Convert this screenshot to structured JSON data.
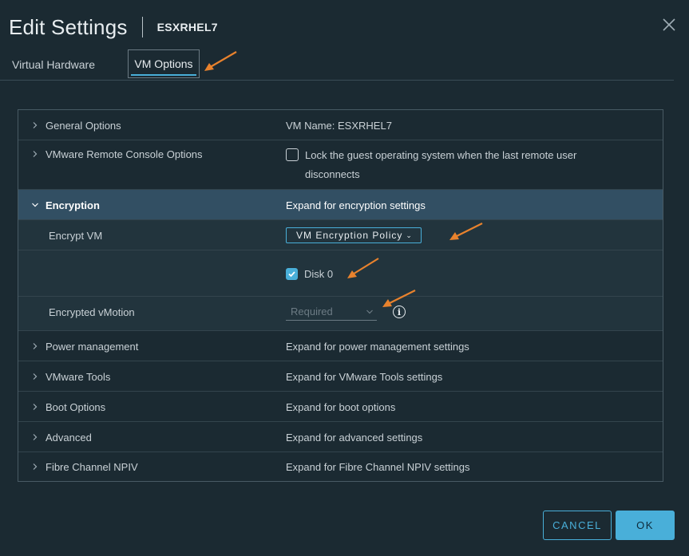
{
  "header": {
    "title": "Edit Settings",
    "subtitle": "ESXRHEL7"
  },
  "tabs": [
    {
      "label": "Virtual Hardware",
      "active": false
    },
    {
      "label": "VM Options",
      "active": true
    }
  ],
  "rows": {
    "general": {
      "label": "General Options",
      "value": "VM Name: ESXRHEL7"
    },
    "remote_console": {
      "label": "VMware Remote Console Options",
      "checkbox_label_line1": "Lock the guest operating system when the last remote user",
      "checkbox_label_line2": "disconnects",
      "checked": false
    },
    "encryption": {
      "label": "Encryption",
      "value": "Expand for encryption settings"
    },
    "encrypt_vm": {
      "label": "Encrypt VM",
      "policy": "VM Encryption Policy"
    },
    "disk": {
      "label": "Disk 0",
      "checked": true
    },
    "encrypted_vmotion": {
      "label": "Encrypted vMotion",
      "selected": "Required"
    },
    "power": {
      "label": "Power management",
      "value": "Expand for power management settings"
    },
    "tools": {
      "label": "VMware Tools",
      "value": "Expand for VMware Tools settings"
    },
    "boot": {
      "label": "Boot Options",
      "value": "Expand for boot options"
    },
    "advanced": {
      "label": "Advanced",
      "value": "Expand for advanced settings"
    },
    "npiv": {
      "label": "Fibre Channel NPIV",
      "value": "Expand for Fibre Channel NPIV settings"
    }
  },
  "footer": {
    "cancel_label": "CANCEL",
    "ok_label": "OK"
  },
  "colors": {
    "background": "#1b2a32",
    "accent": "#49afd9",
    "selected_row": "#324f63",
    "annotation_arrow": "#e8822d"
  },
  "icons": [
    "close-icon",
    "chevron-right-icon",
    "chevron-down-icon",
    "checkmark-icon",
    "info-icon",
    "dropdown-caret-icon",
    "annotation-arrow-icon"
  ]
}
